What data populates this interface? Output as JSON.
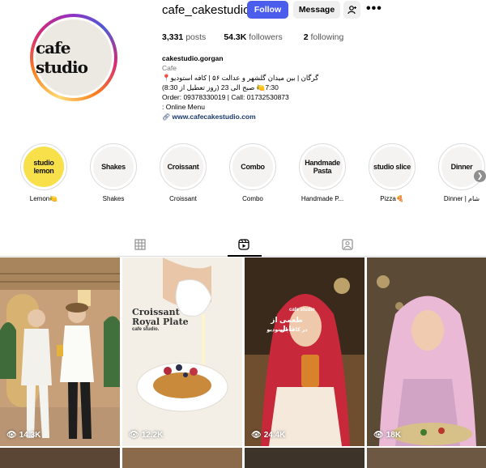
{
  "profile": {
    "username": "cafe_cakestudio",
    "avatar_logo": "cafe studio",
    "follow_label": "Follow",
    "message_label": "Message",
    "posts_count": "3,331",
    "posts_label": "posts",
    "followers_count": "54.3K",
    "followers_label": "followers",
    "following_count": "2",
    "following_label": "following"
  },
  "bio": {
    "name": "cakestudio.gorgan",
    "category": "Cafe",
    "line1": "گرگان | بین میدان گلشهر و عدالت ۵۶ | کافه استودیو📍",
    "line2": "7:30🍋 صبح الی 23 (روز تعطیل از 8:30)",
    "line3": "Order: 09378330019 | Call: 01732530873",
    "line4": ": Online Menu",
    "link": "www.cafecakestudio.com"
  },
  "highlights": [
    {
      "inner": "studio lemon",
      "label": "Lemon🍋"
    },
    {
      "inner": "Shakes",
      "label": "Shakes"
    },
    {
      "inner": "Croissant",
      "label": "Croissant"
    },
    {
      "inner": "Combo",
      "label": "Combo"
    },
    {
      "inner": "Handmade Pasta",
      "label": "Handmade P..."
    },
    {
      "inner": "studio slice",
      "label": "Pizza🍕"
    },
    {
      "inner": "Dinner",
      "label": "Dinner | شام"
    }
  ],
  "posts": [
    {
      "views": "14.3K"
    },
    {
      "views": "12.2K",
      "overlay_title": "Croissant Royal Plate",
      "overlay_sub": "cafe studio."
    },
    {
      "views": "24.4K",
      "overlay_brand": "cafe studio",
      "overlay_text1": "طعمی از تابل",
      "overlay_text2": "در کافه استودیو"
    },
    {
      "views": "18K"
    }
  ],
  "colors": {
    "follow": "#4a5ded",
    "link": "#1a3a6e"
  }
}
